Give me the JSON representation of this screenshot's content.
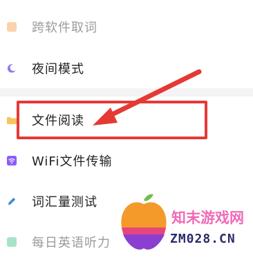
{
  "menu": {
    "items": [
      {
        "label": "跨软件取词",
        "icon": "orange-square-icon"
      },
      {
        "label": "夜间模式",
        "icon": "moon-icon"
      },
      {
        "label": "文件阅读",
        "icon": "folder-icon"
      },
      {
        "label": "WiFi文件传输",
        "icon": "wifi-icon"
      },
      {
        "label": "词汇量测试",
        "icon": "pen-icon"
      },
      {
        "label": "每日英语听力",
        "icon": "headphone-icon"
      }
    ]
  },
  "watermark": {
    "brand_cn": "知末游戏网",
    "domain": "ZM028.CN"
  },
  "colors": {
    "highlight": "#e53935",
    "accent_purple": "#8a5cf6",
    "brand_pink": "#f06ab8"
  }
}
